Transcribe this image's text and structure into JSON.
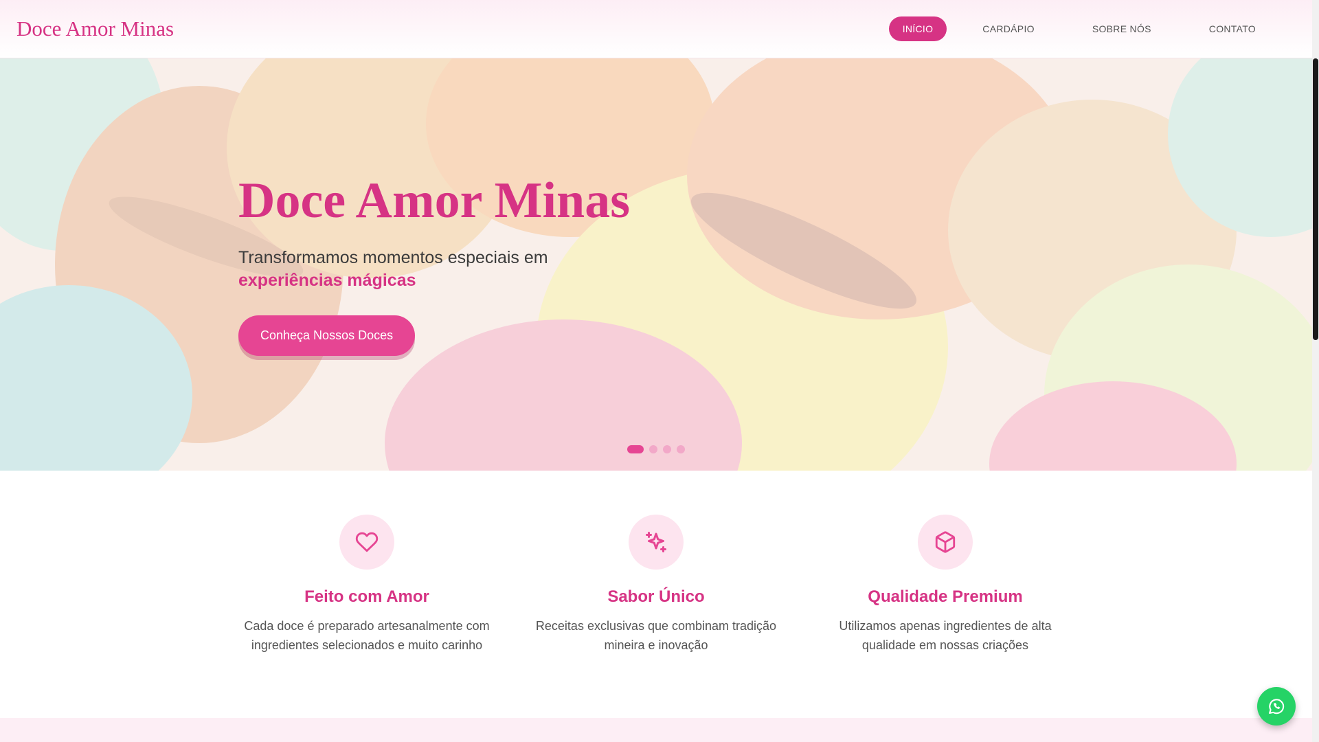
{
  "header": {
    "brand": "Doce Amor Minas",
    "nav": [
      {
        "label": "INÍCIO",
        "active": true
      },
      {
        "label": "CARDÁPIO",
        "active": false
      },
      {
        "label": "SOBRE NÓS",
        "active": false
      },
      {
        "label": "CONTATO",
        "active": false
      }
    ]
  },
  "hero": {
    "title": "Doce Amor Minas",
    "subtitle": "Transformamos momentos especiais em",
    "subtitle_emphasis": "experiências mágicas",
    "cta_label": "Conheça Nossos Doces",
    "slides_count": 4,
    "active_slide": 1
  },
  "features": [
    {
      "icon": "heart-icon",
      "title": "Feito com Amor",
      "text": "Cada doce é preparado artesanalmente com ingredientes selecionados e muito carinho"
    },
    {
      "icon": "sparkles-icon",
      "title": "Sabor Único",
      "text": "Receitas exclusivas que combinam tradição mineira e inovação"
    },
    {
      "icon": "box-icon",
      "title": "Qualidade Premium",
      "text": "Utilizamos apenas ingredientes de alta qualidade em nossas criações"
    }
  ],
  "colors": {
    "accent": "#d63384",
    "accent_bright": "#e64593",
    "whatsapp": "#25d366"
  },
  "floating": {
    "icon": "whatsapp-icon"
  }
}
